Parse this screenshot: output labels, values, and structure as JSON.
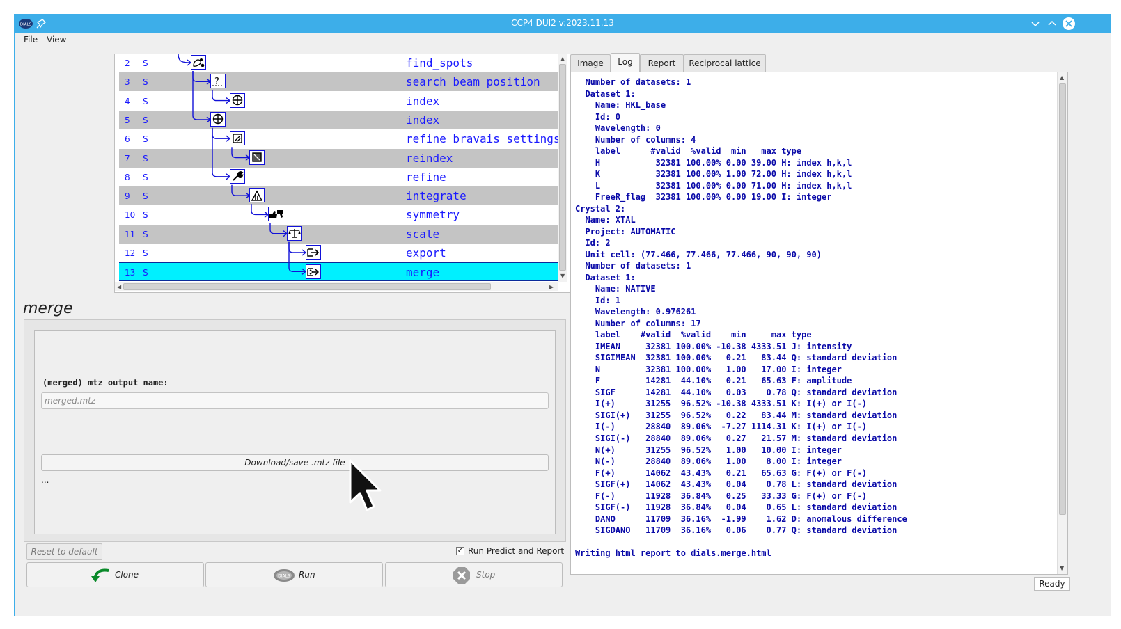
{
  "window": {
    "title": "CCP4 DUI2 v:2023.11.13",
    "logo_text": "DIALS"
  },
  "menu": {
    "items": [
      "File",
      "View"
    ]
  },
  "tree": {
    "rows": [
      {
        "num": "2",
        "state": "S",
        "command": "find_spots",
        "icon": "find-spots-icon"
      },
      {
        "num": "3",
        "state": "S",
        "command": "search_beam_position",
        "icon": "search-beam-icon"
      },
      {
        "num": "4",
        "state": "S",
        "command": "index",
        "icon": "index-icon"
      },
      {
        "num": "5",
        "state": "S",
        "command": "index",
        "icon": "index-icon"
      },
      {
        "num": "6",
        "state": "S",
        "command": "refine_bravais_settings",
        "icon": "bravais-icon"
      },
      {
        "num": "7",
        "state": "S",
        "command": "reindex",
        "icon": "reindex-icon"
      },
      {
        "num": "8",
        "state": "S",
        "command": "refine",
        "icon": "wrench-icon"
      },
      {
        "num": "9",
        "state": "S",
        "command": "integrate",
        "icon": "integrate-icon"
      },
      {
        "num": "10",
        "state": "S",
        "command": "symmetry",
        "icon": "thumbs-icon"
      },
      {
        "num": "11",
        "state": "S",
        "command": "scale",
        "icon": "balance-scale-icon"
      },
      {
        "num": "12",
        "state": "S",
        "command": "export",
        "icon": "export-icon"
      },
      {
        "num": "13",
        "state": "S",
        "command": "merge",
        "icon": "merge-icon"
      }
    ],
    "selected_row_num": "13"
  },
  "step": {
    "title": "merge",
    "mtz_label": "(merged) mtz output name:",
    "mtz_placeholder": "merged.mtz",
    "download_label": "Download/save .mtz file",
    "dots": "...",
    "reset_label": "Reset to default",
    "run_predict_label": "Run Predict and Report",
    "run_predict_checked": true
  },
  "actions": {
    "clone": "Clone",
    "run": "Run",
    "stop": "Stop"
  },
  "tabs": [
    {
      "label": "Image",
      "active": false
    },
    {
      "label": "Log",
      "active": true
    },
    {
      "label": "Report",
      "active": false
    },
    {
      "label": "Reciprocal lattice",
      "active": false
    }
  ],
  "log": {
    "lines": [
      "  Number of datasets: 1",
      "  Dataset 1:",
      "    Name: HKL_base",
      "    Id: 0",
      "    Wavelength: 0",
      "    Number of columns: 4",
      "    label      #valid  %valid  min   max type",
      "    H           32381 100.00% 0.00 39.00 H: index h,k,l",
      "    K           32381 100.00% 1.00 72.00 H: index h,k,l",
      "    L           32381 100.00% 0.00 71.00 H: index h,k,l",
      "    FreeR_flag  32381 100.00% 0.00 19.00 I: integer",
      "Crystal 2:",
      "  Name: XTAL",
      "  Project: AUTOMATIC",
      "  Id: 2",
      "  Unit cell: (77.466, 77.466, 77.466, 90, 90, 90)",
      "  Number of datasets: 1",
      "  Dataset 1:",
      "    Name: NATIVE",
      "    Id: 1",
      "    Wavelength: 0.976261",
      "    Number of columns: 17",
      "    label    #valid  %valid    min     max type",
      "    IMEAN     32381 100.00% -10.38 4333.51 J: intensity",
      "    SIGIMEAN  32381 100.00%   0.21   83.44 Q: standard deviation",
      "    N         32381 100.00%   1.00   17.00 I: integer",
      "    F         14281  44.10%   0.21   65.63 F: amplitude",
      "    SIGF      14281  44.10%   0.03    0.78 Q: standard deviation",
      "    I(+)      31255  96.52% -10.38 4333.51 K: I(+) or I(-)",
      "    SIGI(+)   31255  96.52%   0.22   83.44 M: standard deviation",
      "    I(-)      28840  89.06%  -7.27 1114.31 K: I(+) or I(-)",
      "    SIGI(-)   28840  89.06%   0.27   21.57 M: standard deviation",
      "    N(+)      31255  96.52%   1.00   10.00 I: integer",
      "    N(-)      28840  89.06%   1.00    8.00 I: integer",
      "    F(+)      14062  43.43%   0.21   65.63 G: F(+) or F(-)",
      "    SIGF(+)   14062  43.43%   0.04    0.78 L: standard deviation",
      "    F(-)      11928  36.84%   0.25   33.33 G: F(+) or F(-)",
      "    SIGF(-)   11928  36.84%   0.04    0.65 L: standard deviation",
      "    DANO      11709  36.16%  -1.99    1.62 D: anomalous difference",
      "    SIGDANO   11709  36.16%   0.06    0.77 Q: standard deviation",
      "",
      "Writing html report to dials.merge.html"
    ]
  },
  "status": {
    "text": "Ready"
  },
  "colors": {
    "accent": "#3daee9",
    "tree_text": "#1a1aff",
    "selected_row": "#00f0ff",
    "log_text": "#0a0aa8"
  }
}
